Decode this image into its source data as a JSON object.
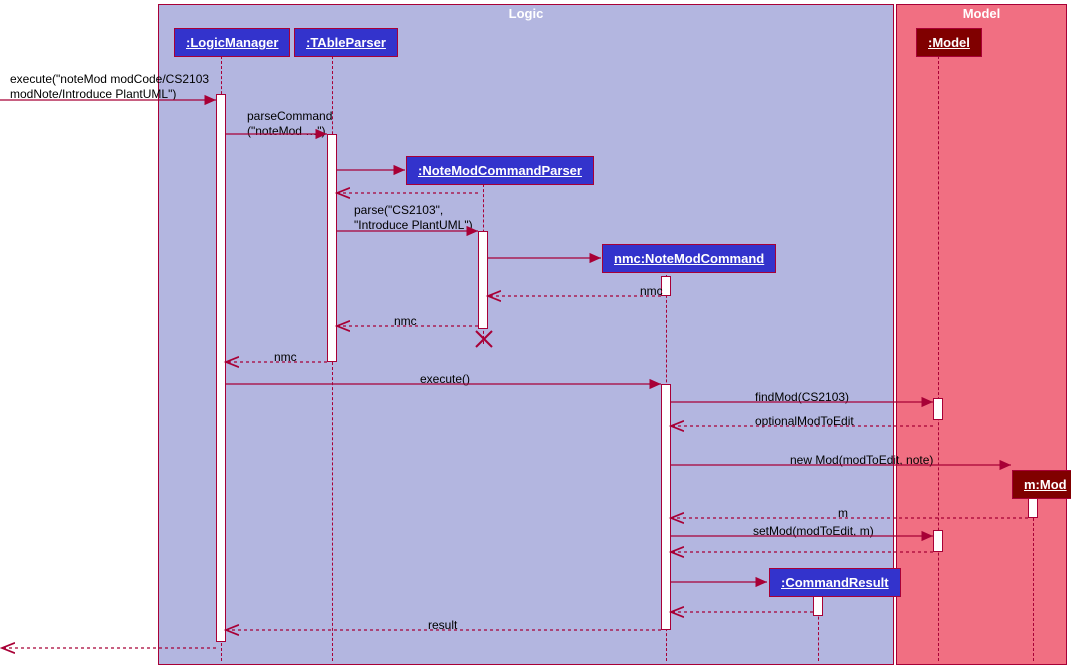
{
  "diagram_type": "UML Sequence Diagram",
  "regions": {
    "logic": {
      "title": "Logic"
    },
    "model": {
      "title": "Model"
    }
  },
  "participants": {
    "logicManager": {
      "label": ":LogicManager"
    },
    "tableParser": {
      "label": ":TAbleParser"
    },
    "noteModParser": {
      "label": ":NoteModCommandParser"
    },
    "noteModCommand": {
      "label": "nmc:NoteModCommand"
    },
    "commandResult": {
      "label": ":CommandResult"
    },
    "model": {
      "label": ":Model"
    },
    "mod": {
      "label": "m:Mod"
    }
  },
  "messages": {
    "entry": {
      "text1": "execute(\"noteMod modCode/CS2103",
      "text2": "modNote/Introduce PlantUML\")"
    },
    "parseCommand": {
      "text1": "parseCommand",
      "text2": "(\"noteMod …\")"
    },
    "createParser": {
      "text": ""
    },
    "parseCall": {
      "text1": "parse(\"CS2103\",",
      "text2": "\"Introduce PlantUML\")"
    },
    "createCmd": {
      "text": ""
    },
    "retNmc1": {
      "text": "nmc"
    },
    "retNmc2": {
      "text": "nmc"
    },
    "retNmc3": {
      "text": "nmc"
    },
    "execute": {
      "text": "execute()"
    },
    "findMod": {
      "text": "findMod(CS2103)"
    },
    "retOptional": {
      "text": "optionalModToEdit"
    },
    "newMod": {
      "text": "new Mod(modToEdit, note)"
    },
    "retM": {
      "text": "m"
    },
    "setMod": {
      "text": "setMod(modToEdit, m)"
    },
    "retSetMod": {
      "text": ""
    },
    "createResult": {
      "text": ""
    },
    "retCreateRes": {
      "text": ""
    },
    "retResult": {
      "text": "result"
    },
    "exit": {
      "text": ""
    }
  }
}
